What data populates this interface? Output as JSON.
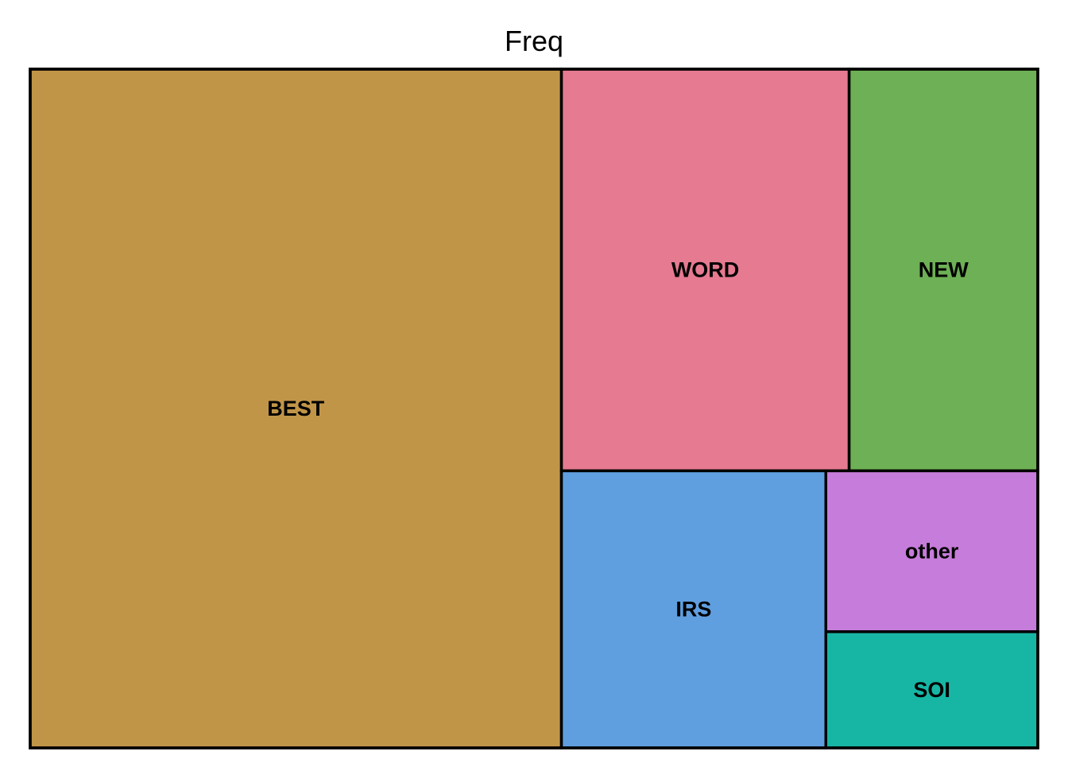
{
  "chart_data": {
    "type": "treemap",
    "title": "Freq",
    "tiles": [
      {
        "label": "BEST",
        "value": 571,
        "color": "#C19548"
      },
      {
        "label": "WORD",
        "value": 183,
        "color": "#E57A90"
      },
      {
        "label": "NEW",
        "value": 120,
        "color": "#6EB055"
      },
      {
        "label": "IRS",
        "value": 116,
        "color": "#5F9FE0"
      },
      {
        "label": "other",
        "value": 54,
        "color": "#C67CDA"
      },
      {
        "label": "SOI",
        "value": 39,
        "color": "#17B6A4"
      }
    ],
    "border_color": "#000000"
  }
}
